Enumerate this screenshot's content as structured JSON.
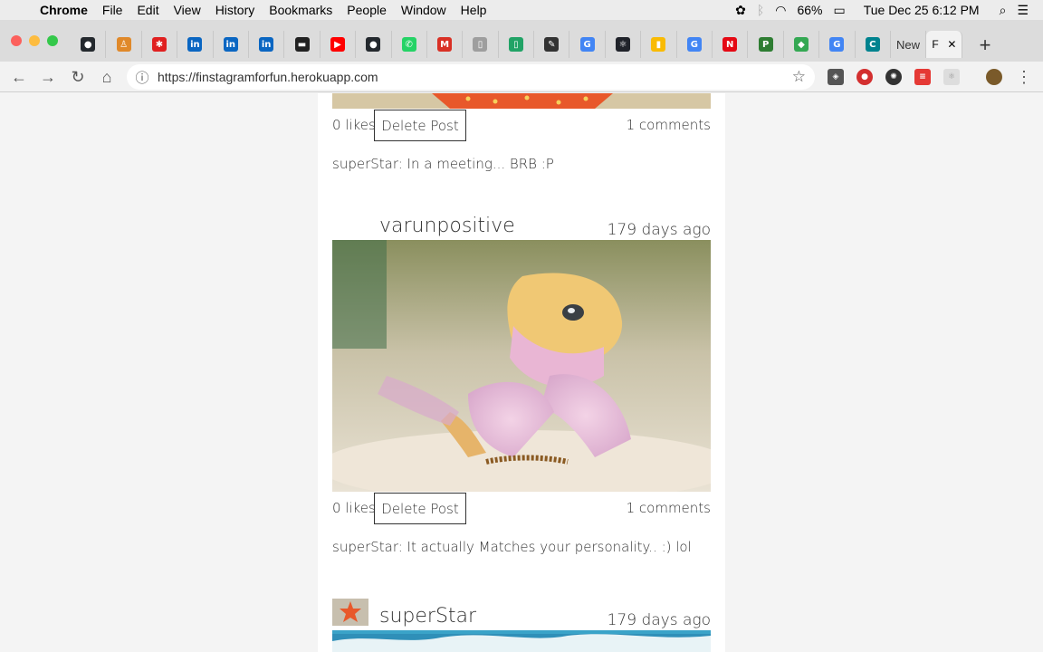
{
  "menubar": {
    "app": "Chrome",
    "items": [
      "File",
      "Edit",
      "View",
      "History",
      "Bookmarks",
      "People",
      "Window",
      "Help"
    ],
    "battery": "66%",
    "clock": "Tue Dec 25  6:12 PM"
  },
  "tabs": [
    {
      "icon": "github-icon",
      "color": "#24292e",
      "glyph": "●"
    },
    {
      "icon": "person-icon",
      "color": "#e0892a",
      "glyph": "♙"
    },
    {
      "icon": "lips-icon",
      "color": "#e02020",
      "glyph": "✱"
    },
    {
      "icon": "linkedin-icon",
      "color": "#0a66c2",
      "glyph": "in"
    },
    {
      "icon": "linkedin-icon",
      "color": "#0a66c2",
      "glyph": "in"
    },
    {
      "icon": "linkedin-icon",
      "color": "#0a66c2",
      "glyph": "in"
    },
    {
      "icon": "imdb-icon",
      "color": "#222222",
      "glyph": "▬"
    },
    {
      "icon": "youtube-icon",
      "color": "#ff0000",
      "glyph": "▶"
    },
    {
      "icon": "github-icon",
      "color": "#24292e",
      "glyph": "●"
    },
    {
      "icon": "whatsapp-icon",
      "color": "#25d366",
      "glyph": "✆"
    },
    {
      "icon": "gmail-icon",
      "color": "#d93025",
      "glyph": "M"
    },
    {
      "icon": "document-icon",
      "color": "#9e9e9e",
      "glyph": "▯"
    },
    {
      "icon": "sheets-icon",
      "color": "#21a366",
      "glyph": "▯"
    },
    {
      "icon": "pencil-icon",
      "color": "#333333",
      "glyph": "✎"
    },
    {
      "icon": "google-icon",
      "color": "#4285f4",
      "glyph": "G"
    },
    {
      "icon": "react-icon",
      "color": "#20232a",
      "glyph": "⚛"
    },
    {
      "icon": "keep-icon",
      "color": "#f9bb05",
      "glyph": "▮"
    },
    {
      "icon": "google-icon",
      "color": "#4285f4",
      "glyph": "G"
    },
    {
      "icon": "netflix-icon",
      "color": "#e50914",
      "glyph": "N"
    },
    {
      "icon": "p-icon",
      "color": "#2e7d32",
      "glyph": "P"
    },
    {
      "icon": "maps-icon",
      "color": "#34a853",
      "glyph": "◆"
    },
    {
      "icon": "google-icon",
      "color": "#4285f4",
      "glyph": "G"
    },
    {
      "icon": "c-icon",
      "color": "#00838f",
      "glyph": "C"
    }
  ],
  "tab_new_label": "New",
  "tab_active_label": "F",
  "url": "https://finstagramforfun.herokuapp.com",
  "posts": [
    {
      "likes": "0 likes",
      "delete_label": "Delete Post",
      "comments_count": "1 comments",
      "comment": "superStar: In a meeting... BRB :P"
    },
    {
      "username": "varunpositive",
      "time": "179 days ago",
      "likes": "0 likes",
      "delete_label": "Delete Post",
      "comments_count": "1 comments",
      "comment": "superStar: It actually Matches your personality.. :) lol"
    },
    {
      "username": "superStar",
      "time": "179 days ago"
    }
  ]
}
